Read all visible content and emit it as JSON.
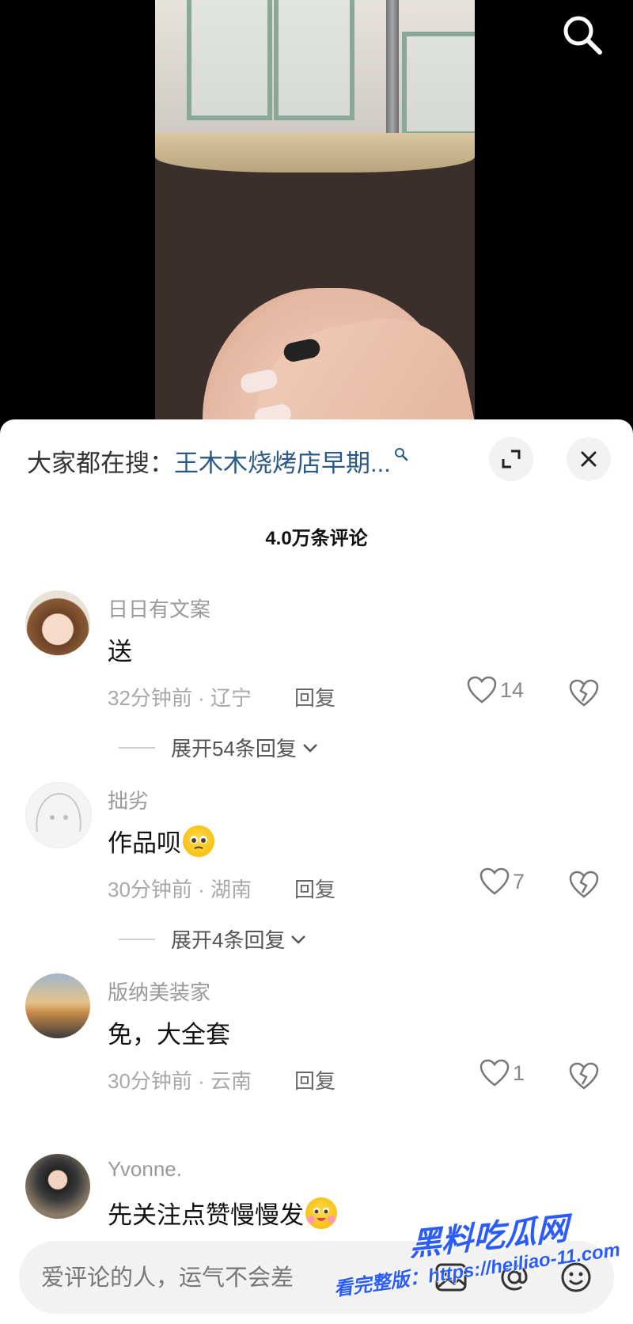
{
  "search_suggest": {
    "label": "大家都在搜：",
    "term": "王木木烧烤店早期..."
  },
  "comments_header": {
    "count_title": "4.0万条评论"
  },
  "comments": [
    {
      "username": "日日有文案",
      "text": "送",
      "time_location": "32分钟前 · 辽宁",
      "reply_label": "回复",
      "likes": "14",
      "expand_label": "展开54条回复"
    },
    {
      "username": "拙劣",
      "text": "作品呗",
      "time_location": "30分钟前 · 湖南",
      "reply_label": "回复",
      "likes": "7",
      "expand_label": "展开4条回复"
    },
    {
      "username": "版纳美装家",
      "text": "免，大全套",
      "time_location": "30分钟前 · 云南",
      "reply_label": "回复",
      "likes": "1"
    },
    {
      "username": "Yvonne.",
      "text": "先关注点赞慢慢发"
    }
  ],
  "input": {
    "placeholder": "爱评论的人，运气不会差"
  },
  "watermark": {
    "title": "黑料吃瓜网",
    "url": "看完整版：https://heiliao-11.com"
  },
  "icons": {
    "search": "search-icon",
    "expand": "expand-icon",
    "close": "close-icon",
    "like": "heart-icon",
    "dislike": "broken-heart-icon",
    "image": "image-icon",
    "mention": "at-icon",
    "emoji": "emoji-icon"
  },
  "colors": {
    "suggest_term": "#2b5a86",
    "watermark": "#2a5cff"
  }
}
